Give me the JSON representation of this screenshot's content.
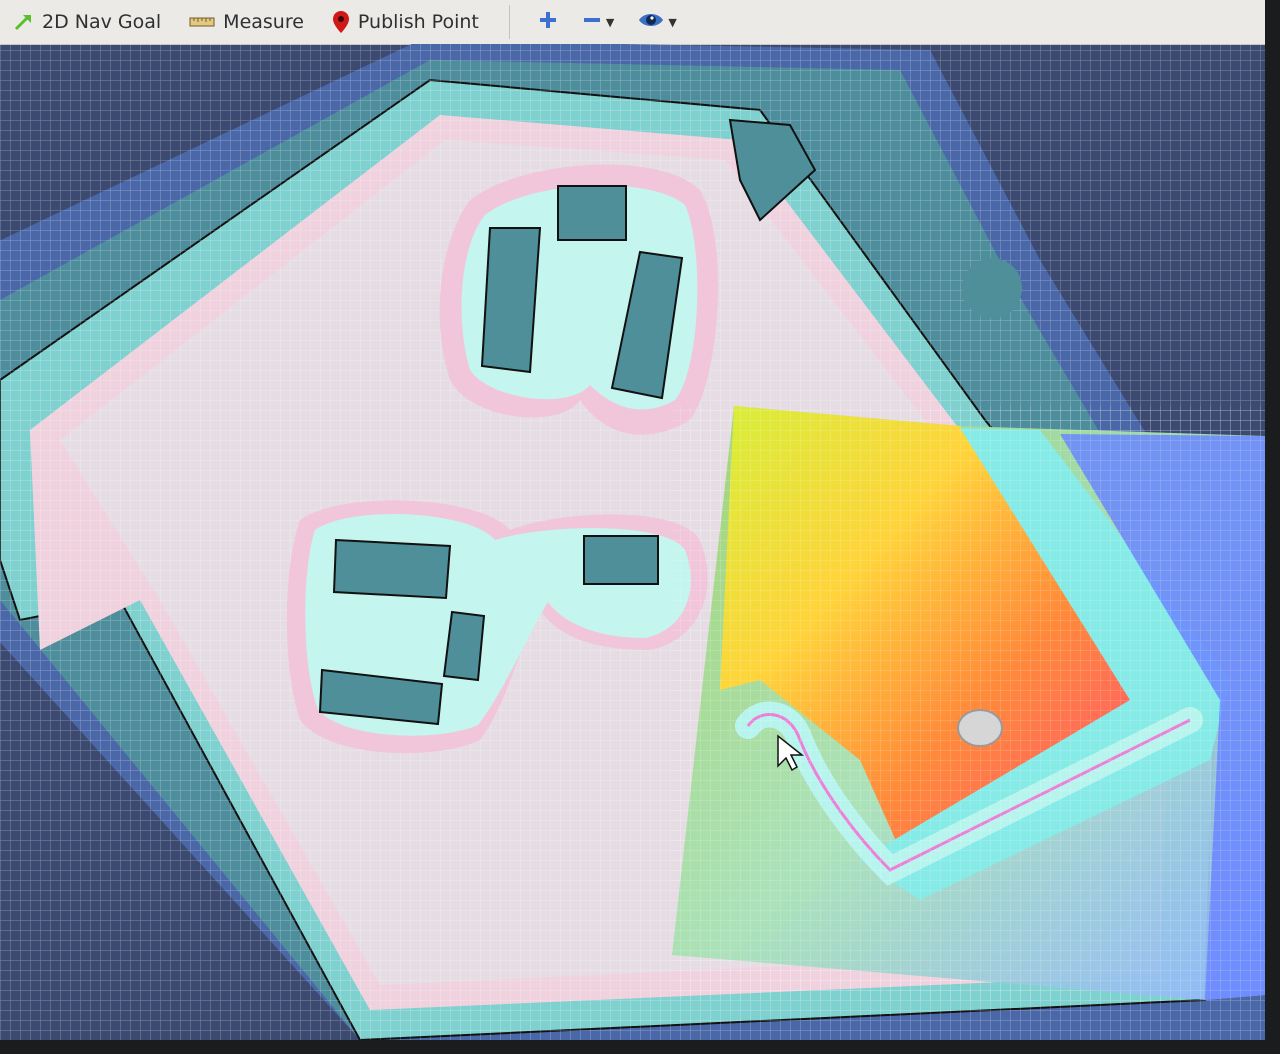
{
  "toolbar": {
    "nav_goal_label": "2D Nav Goal",
    "measure_label": "Measure",
    "publish_point_label": "Publish Point"
  },
  "icons": {
    "nav_goal": "arrow-icon",
    "measure": "ruler-icon",
    "publish_point": "map-pin-icon",
    "zoom_in": "plus-icon",
    "zoom_out": "minus-icon",
    "view": "eye-icon"
  },
  "colors": {
    "toolbar_bg": "#eceae6",
    "map_free": "#e8dfe4",
    "obstacle": "#4f8f9a",
    "inflation_inner": "#b8f4ee",
    "inflation_outer": "#f3c3d6",
    "costmap_high": "#ffe14a",
    "costmap_low": "#ff5e74",
    "background": "#3c4a72",
    "publish_pin": "#d01818",
    "nav_goal_arrow": "#5bbf2a"
  }
}
